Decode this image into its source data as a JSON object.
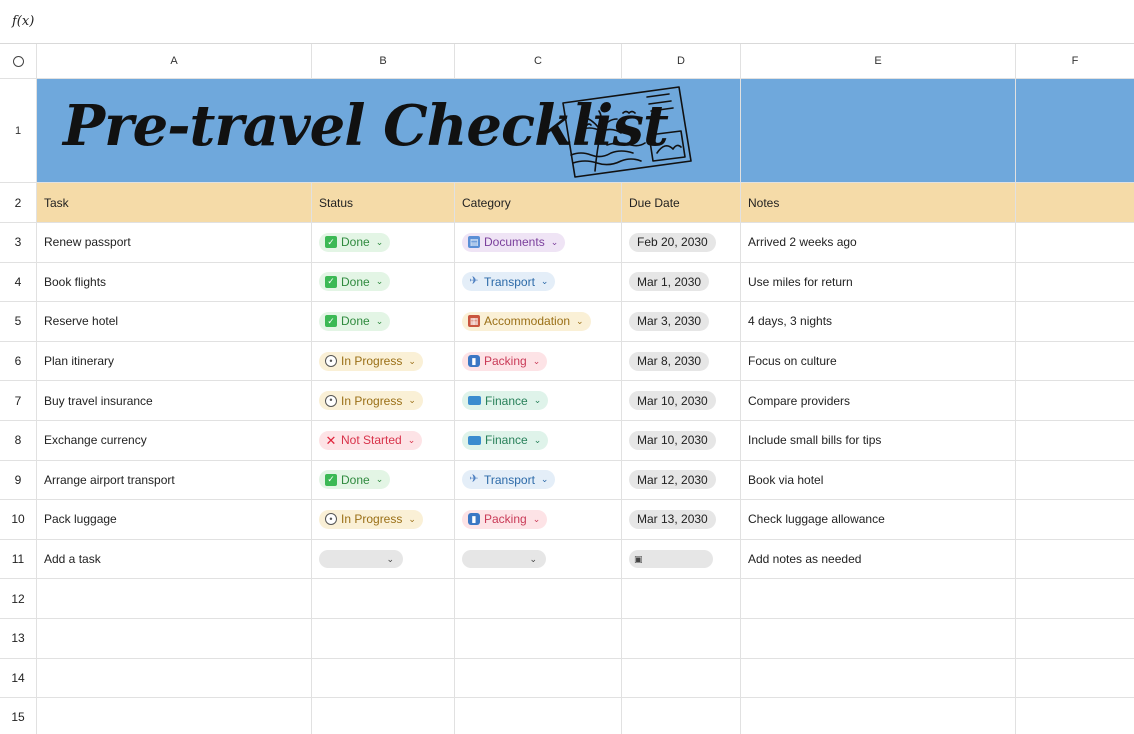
{
  "formula_bar": {
    "fx_label": "f(x)",
    "value": ""
  },
  "columns": [
    "A",
    "B",
    "C",
    "D",
    "E",
    "F"
  ],
  "title": "Pre-travel Checklist",
  "headers": {
    "task": "Task",
    "status": "Status",
    "category": "Category",
    "due_date": "Due Date",
    "notes": "Notes"
  },
  "colors": {
    "banner": "#6fa8dc",
    "header": "#f5dba8"
  },
  "rows": [
    {
      "num": "3",
      "task": "Renew passport",
      "status": "Done",
      "status_kind": "done",
      "status_icon": "check-box-icon",
      "category": "Documents",
      "category_kind": "doc",
      "category_icon": "id-card-icon",
      "due": "Feb 20, 2030",
      "notes": "Arrived 2 weeks ago"
    },
    {
      "num": "4",
      "task": "Book flights",
      "status": "Done",
      "status_kind": "done",
      "status_icon": "check-box-icon",
      "category": "Transport",
      "category_kind": "tra",
      "category_icon": "airplane-icon",
      "due": "Mar 1, 2030",
      "notes": "Use miles for return"
    },
    {
      "num": "5",
      "task": "Reserve hotel",
      "status": "Done",
      "status_kind": "done",
      "status_icon": "check-box-icon",
      "category": "Accommodation",
      "category_kind": "acc",
      "category_icon": "hotel-icon",
      "due": "Mar 3, 2030",
      "notes": "4 days, 3 nights"
    },
    {
      "num": "6",
      "task": "Plan itinerary",
      "status": "In Progress",
      "status_kind": "prog",
      "status_icon": "clock-icon",
      "category": "Packing",
      "category_kind": "pac",
      "category_icon": "luggage-icon",
      "due": "Mar 8, 2030",
      "notes": "Focus on culture"
    },
    {
      "num": "7",
      "task": "Buy travel insurance",
      "status": "In Progress",
      "status_kind": "prog",
      "status_icon": "clock-icon",
      "category": "Finance",
      "category_kind": "fin",
      "category_icon": "credit-card-icon",
      "due": "Mar 10, 2030",
      "notes": "Compare providers"
    },
    {
      "num": "8",
      "task": "Exchange currency",
      "status": "Not Started",
      "status_kind": "not",
      "status_icon": "cross-icon",
      "category": "Finance",
      "category_kind": "fin",
      "category_icon": "credit-card-icon",
      "due": "Mar 10, 2030",
      "notes": "Include small bills for tips"
    },
    {
      "num": "9",
      "task": "Arrange airport transport",
      "status": "Done",
      "status_kind": "done",
      "status_icon": "check-box-icon",
      "category": "Transport",
      "category_kind": "tra",
      "category_icon": "airplane-icon",
      "due": "Mar 12, 2030",
      "notes": "Book via hotel"
    },
    {
      "num": "10",
      "task": "Pack luggage",
      "status": "In Progress",
      "status_kind": "prog",
      "status_icon": "clock-icon",
      "category": "Packing",
      "category_kind": "pac",
      "category_icon": "luggage-icon",
      "due": "Mar 13, 2030",
      "notes": "Check luggage allowance"
    }
  ],
  "add_row": {
    "num": "11",
    "task": "Add a task",
    "notes": "Add notes as needed"
  },
  "empty_rows": [
    "12",
    "13",
    "14",
    "15"
  ]
}
